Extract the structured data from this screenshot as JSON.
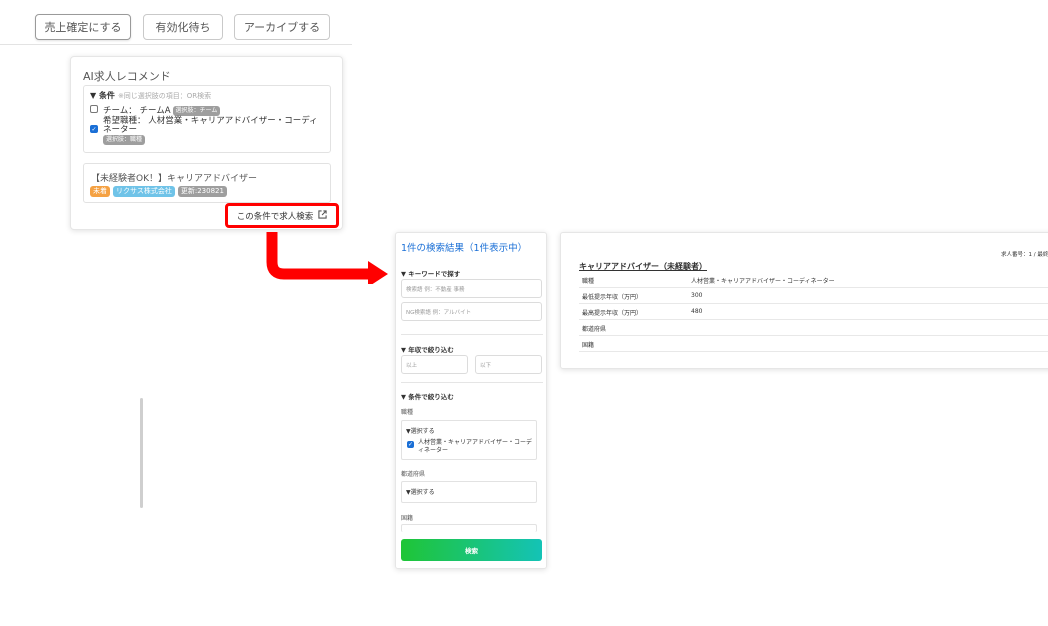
{
  "top_actions": {
    "confirm_sales": "売上確定にする",
    "pending_valid": "有効化待ち",
    "archive": "アーカイブする"
  },
  "ai_card": {
    "title": "AI求人レコメンド",
    "conditions_header": "▼ 条件",
    "conditions_note": "※同じ選択肢の項目：OR検索",
    "team_label": "チーム： チームA",
    "team_tag": "選択肢：チーム",
    "job_type_label": "希望職種： 人材営業・キャリアアドバイザー・コーディネーター",
    "job_type_tag": "選択肢：職種",
    "job_title": "【未経験者OK！】キャリアアドバイザー",
    "job_tags": [
      "未着",
      "リクサス株式会社",
      "更新:230821"
    ],
    "search_link": "この条件で求人検索"
  },
  "search_panel": {
    "title": "1件の検索結果（1件表示中）",
    "keyword_section": "▼ キーワードで探す",
    "keyword_placeholder": "検索語 例：不動産 事務",
    "ng_keyword_placeholder": "NG検索語 例：アルバイト",
    "salary_section": "▼ 年収で絞り込む",
    "salary_min_placeholder": "以上",
    "salary_max_placeholder": "以下",
    "condition_section": "▼ 条件で絞り込む",
    "job_type_label": "職種",
    "select_label": "▼選択する",
    "job_type_option": "人材営業・キャリアアドバイザー・コーディネーター",
    "prefecture_label": "都道府県",
    "prefecture_select": "▼選択する",
    "nationality_label": "国籍",
    "search_button": "検索"
  },
  "detail_panel": {
    "job_number": "求人番号：1 / 最終",
    "title": "キャリアアドバイザー（未経験者）",
    "rows": [
      {
        "key": "職種",
        "value": "人材営業・キャリアアドバイザー・コーディネーター"
      },
      {
        "key": "最低提示年収（万円）",
        "value": "300"
      },
      {
        "key": "最高提示年収（万円）",
        "value": "480"
      },
      {
        "key": "都道府県",
        "value": ""
      },
      {
        "key": "国籍",
        "value": ""
      }
    ]
  },
  "colors": {
    "accent_blue": "#1a6fd6",
    "highlight_red": "#ff0000",
    "button_gradient_start": "#1fc536",
    "button_gradient_end": "#14c3b6"
  }
}
